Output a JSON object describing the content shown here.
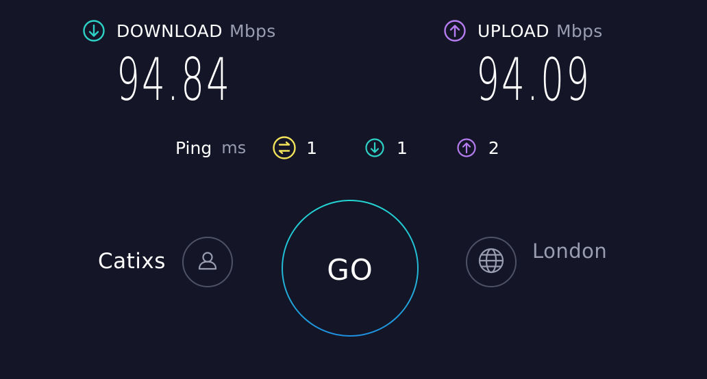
{
  "download": {
    "label": "DOWNLOAD",
    "unit": "Mbps",
    "value": "94.84",
    "icon": "arrow-down-circle-icon",
    "color": "#2ed1c6"
  },
  "upload": {
    "label": "UPLOAD",
    "unit": "Mbps",
    "value": "94.09",
    "icon": "arrow-up-circle-icon",
    "color": "#b57cf0"
  },
  "ping": {
    "label": "Ping",
    "unit": "ms",
    "idle": {
      "value": "1",
      "icon": "ping-idle-icon",
      "color": "#f2e35a"
    },
    "download": {
      "value": "1",
      "icon": "arrow-down-circle-icon",
      "color": "#2ed1c6"
    },
    "upload": {
      "value": "2",
      "icon": "arrow-up-circle-icon",
      "color": "#b57cf0"
    }
  },
  "provider": {
    "name": "Catixs",
    "icon": "user-icon"
  },
  "go_button": {
    "label": "GO"
  },
  "server": {
    "name": "London",
    "icon": "globe-icon"
  },
  "colors": {
    "background": "#141526",
    "text": "#ffffff",
    "muted": "#9a9cb0",
    "ring_start": "#23d6d3",
    "ring_end": "#1f8fe0"
  }
}
